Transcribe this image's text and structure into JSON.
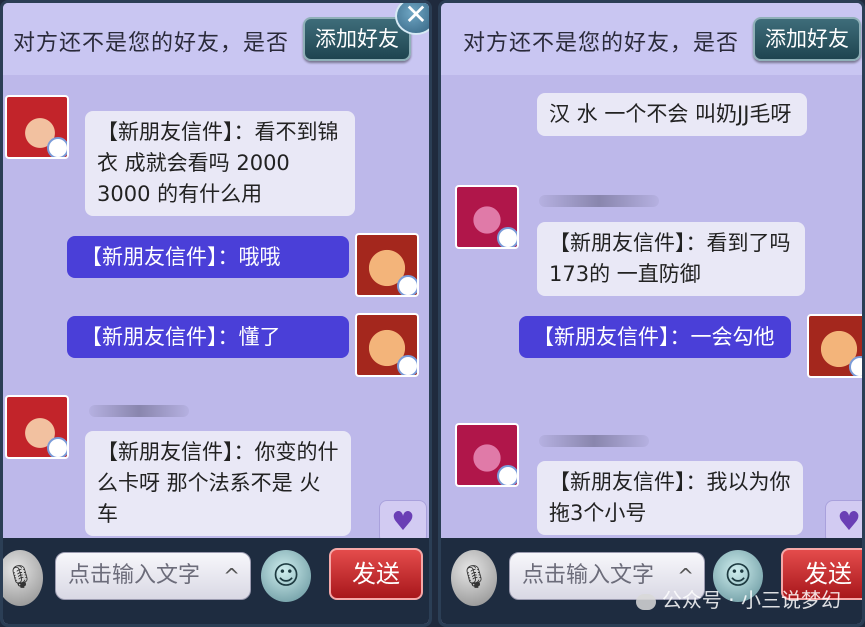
{
  "left": {
    "header_text": "对方还不是您的好友，是否",
    "add_friend": "添加好友",
    "close": "✕",
    "messages": {
      "m1": "【新朋友信件】：看不到锦衣 成就会看吗 2000 3000 的有什么用",
      "m2": "【新朋友信件】：哦哦",
      "m3": "【新朋友信件】：懂了",
      "m4": "【新朋友信件】：你变的什么卡呀 那个法系不是 火车"
    },
    "heart": "♥",
    "input_placeholder": "点击输入文字",
    "send": "发送"
  },
  "right": {
    "header_text": "对方还不是您的好友，是否",
    "add_friend": "添加好友",
    "messages": {
      "m1": "汉 水 一个不会 叫奶JJ毛呀",
      "m2": "【新朋友信件】：看到了吗 173的 一直防御",
      "m3": "【新朋友信件】：一会勾他",
      "m4": "【新朋友信件】：我以为你拖3个小号"
    },
    "heart": "♥",
    "input_placeholder": "点击输入文字",
    "send": "发送"
  },
  "icons": {
    "mic": "🎙",
    "chevron": "^",
    "emoji": "☺"
  },
  "watermark": "公众号 · 小三说梦幻",
  "colors": {
    "panel_bg": "#bdb8ea",
    "bubble_in": "#e9e8f6",
    "bubble_out": "#4a3fd8",
    "send_button": "#c4262b",
    "frame": "#2b3e55"
  }
}
